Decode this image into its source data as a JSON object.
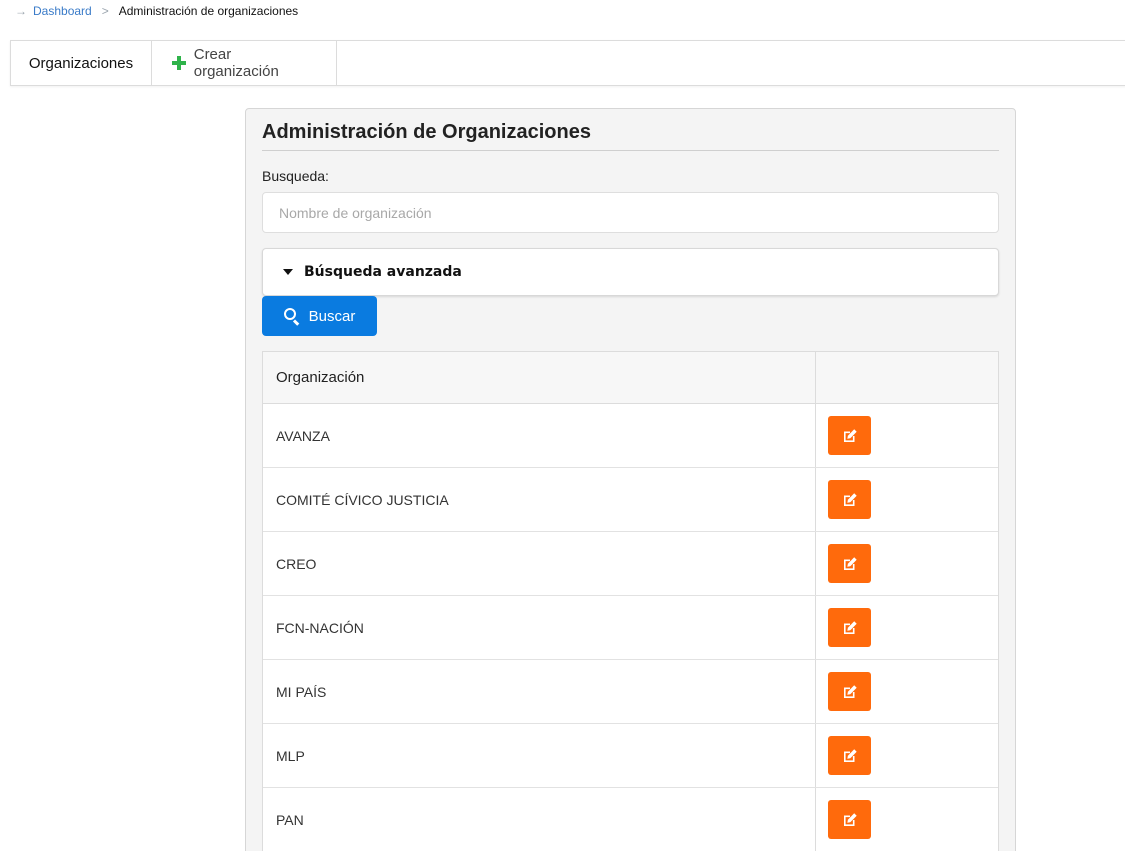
{
  "breadcrumb": {
    "icon": "arrow-right-icon",
    "items": [
      {
        "label": "Dashboard"
      },
      {
        "label": "Administración de organizaciones"
      }
    ],
    "separator_icon": "chevron-right-icon"
  },
  "tabs": [
    {
      "label": "Organizaciones",
      "active": true
    },
    {
      "label": "Crear organización",
      "icon": "plus-icon"
    }
  ],
  "panel": {
    "title": "Administración de Organizaciones",
    "search_label": "Busqueda:",
    "search_placeholder": "Nombre de organización",
    "search_value": "",
    "advanced_label": "Búsqueda avanzada",
    "buscar_label": "Buscar"
  },
  "table": {
    "headers": [
      "Organización",
      ""
    ],
    "rows": [
      {
        "name": "AVANZA"
      },
      {
        "name": "COMITÉ CÍVICO JUSTICIA"
      },
      {
        "name": "CREO"
      },
      {
        "name": "FCN-NACIÓN"
      },
      {
        "name": "MI PAÍS"
      },
      {
        "name": "MLP"
      },
      {
        "name": "PAN"
      }
    ],
    "action_icon": "edit-icon"
  },
  "colors": {
    "primary": "#0a7be0",
    "edit": "#ff6a0c",
    "plus": "#2fb34a",
    "link": "#3a7bc8"
  }
}
